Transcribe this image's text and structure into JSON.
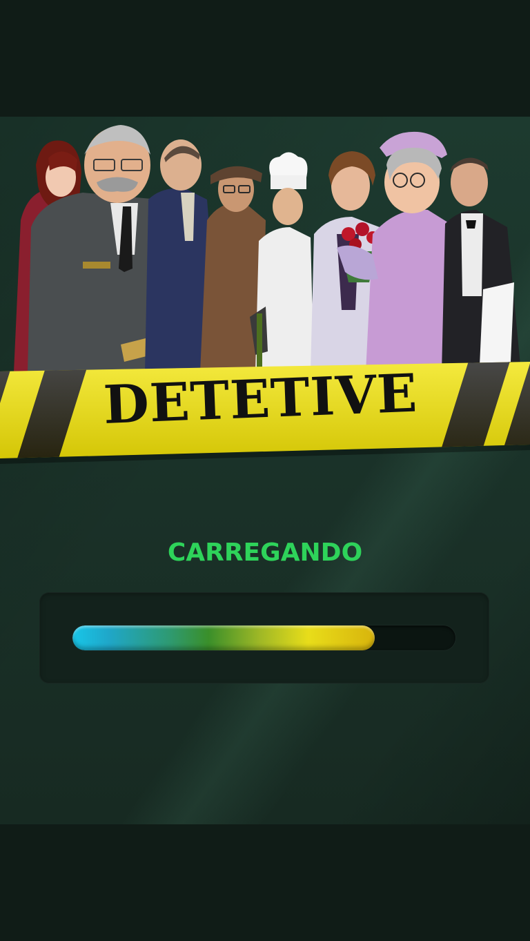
{
  "game": {
    "logo": "DETETIVE"
  },
  "loading": {
    "label": "CARREGANDO",
    "progress": 0.79
  },
  "colors": {
    "background": "#101c17",
    "panel": "#1d3a2f",
    "loading_text": "#2ed35a",
    "tape_yellow": "#f2e400",
    "tape_black": "#0c0c0c"
  }
}
